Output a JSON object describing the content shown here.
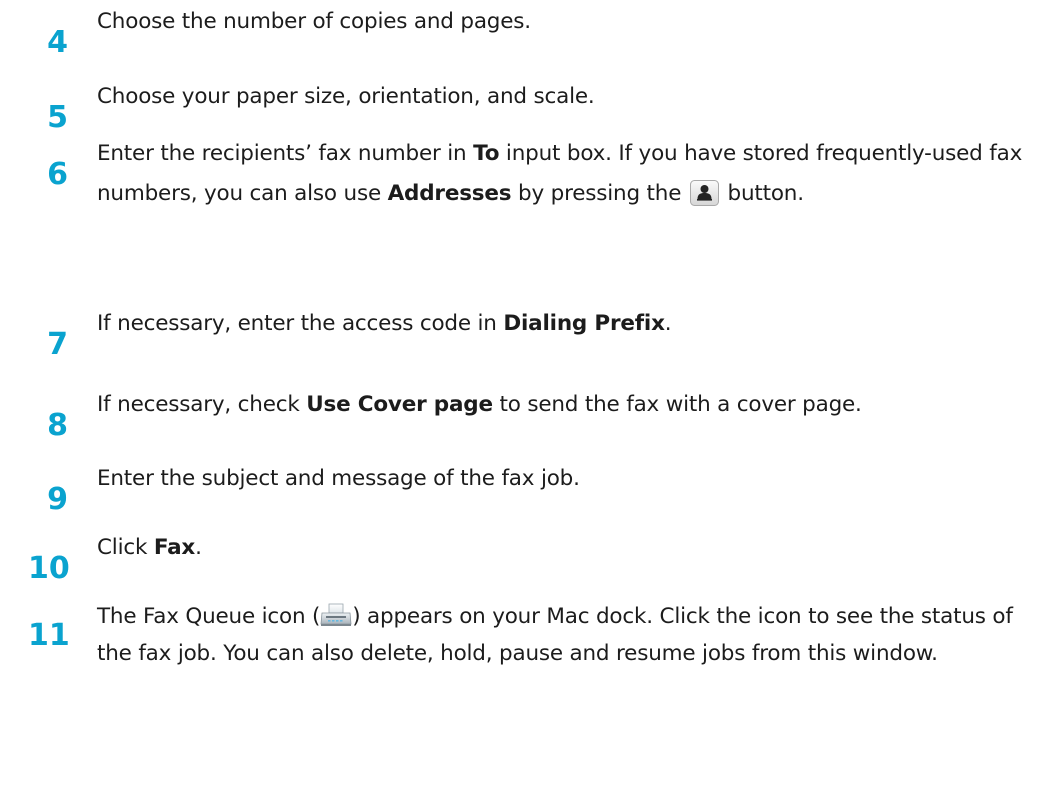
{
  "steps": [
    {
      "number": "4",
      "text": "Choose the number of copies and pages."
    },
    {
      "number": "5",
      "text": "Choose your paper size, orientation, and scale."
    },
    {
      "number": "6",
      "part1": "Enter the recipients’ fax number in ",
      "bold1": "To",
      "part2": " input box. If you have stored frequently-used fax numbers, you can also use ",
      "bold2": "Addresses",
      "part3": " by pressing the ",
      "part4": " button.",
      "icon": "address-book-button-icon"
    },
    {
      "number": "7",
      "part1": "If necessary, enter the access code in ",
      "bold1": "Dialing Prefix",
      "part2": "."
    },
    {
      "number": "8",
      "part1": "If necessary, check ",
      "bold1": "Use Cover page",
      "part2": " to send the fax with a cover page."
    },
    {
      "number": "9",
      "text": "Enter the subject and message of the fax job."
    },
    {
      "number": "10",
      "part1": "Click ",
      "bold1": "Fax",
      "part2": "."
    },
    {
      "number": "11",
      "part1": "The Fax Queue icon (",
      "part2": ") appears on your Mac dock. Click the icon to see the status of the fax job. You can also delete, hold, pause and resume jobs from this window.",
      "icon": "fax-queue-icon"
    }
  ],
  "colors": {
    "step_number": "#0aa3cf",
    "body_text": "#1c1c1c"
  }
}
